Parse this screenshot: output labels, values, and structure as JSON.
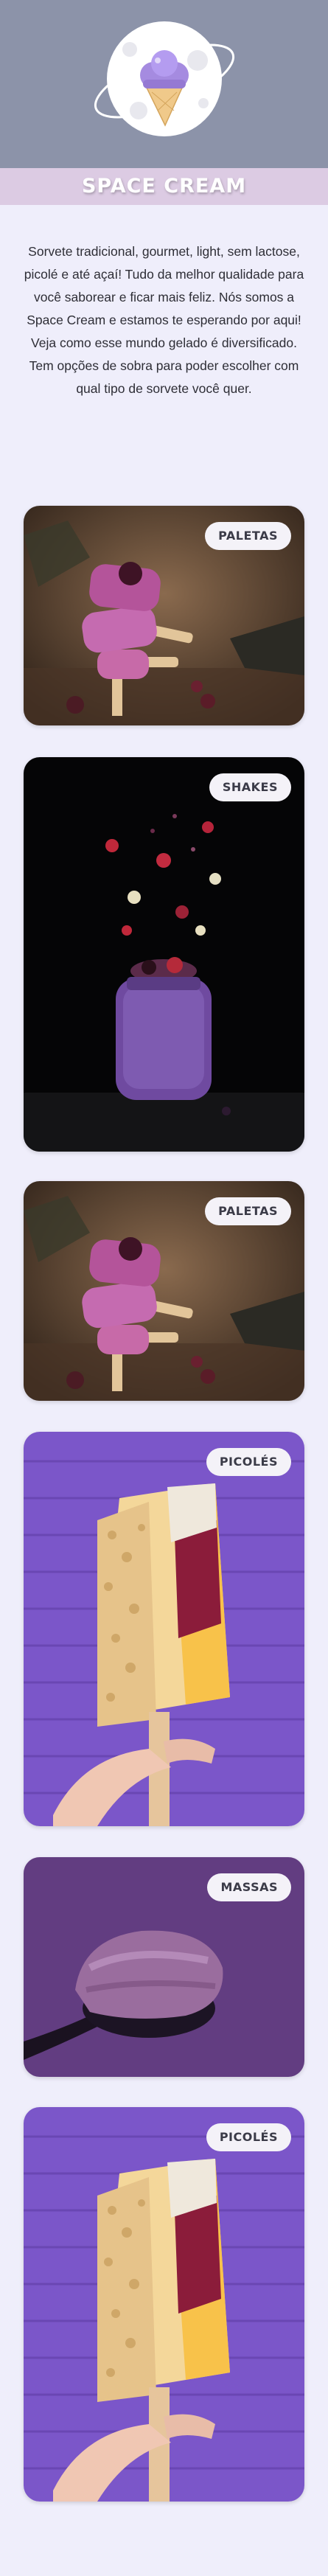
{
  "header": {
    "logo_icon": "ice-cream-planet-icon",
    "title": "SPACE CREAM",
    "colors": {
      "header_bg": "#8c93a9",
      "band": "#dccbe3",
      "page_bg": "#efeefb"
    }
  },
  "intro": {
    "text": "Sorvete tradicional, gourmet, light, sem lactose, picolé e até açaí! Tudo da melhor qualidade para você saborear e ficar mais feliz. Nós somos a Space Cream e estamos te esperando por aqui! Veja como esse mundo gelado é diversificado. Tem opções de sobra para poder escolher com qual tipo de sorvete você quer."
  },
  "cards": [
    {
      "label": "PALETAS",
      "image": "berry-paletas-stack-photo"
    },
    {
      "label": "SHAKES",
      "image": "berry-shake-jar-photo"
    },
    {
      "label": "PALETAS",
      "image": "berry-paletas-stack-photo"
    },
    {
      "label": "PICOLÉS",
      "image": "popsicle-purple-wall-photo"
    },
    {
      "label": "MASSAS",
      "image": "ice-cream-scoop-photo"
    },
    {
      "label": "PICOLÉS",
      "image": "popsicle-purple-wall-photo"
    }
  ]
}
